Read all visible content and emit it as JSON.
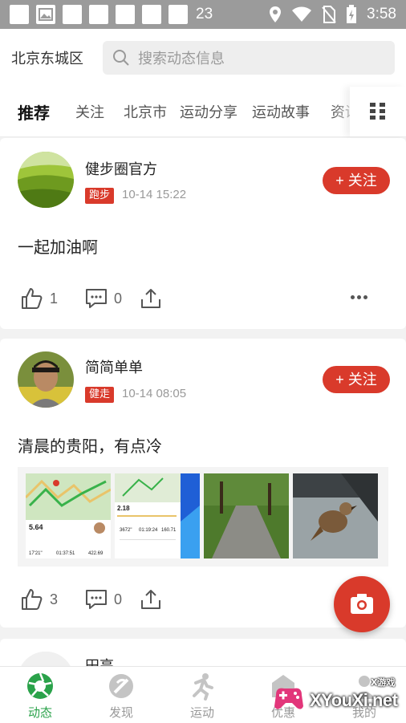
{
  "status_bar": {
    "notification_count": "23",
    "time": "3:58"
  },
  "header": {
    "city": "北京东城区",
    "search_placeholder": "搜索动态信息"
  },
  "tabs": [
    "推荐",
    "关注",
    "北京市",
    "运动分享",
    "运动故事",
    "资讯"
  ],
  "feed": [
    {
      "user": "健步圈官方",
      "tag": "跑步",
      "time": "10-14 15:22",
      "follow_label": "+ 关注",
      "text": "一起加油啊",
      "likes": "1",
      "comments": "0",
      "has_images": false
    },
    {
      "user": "简简单单",
      "tag": "健走",
      "time": "10-14 08:05",
      "follow_label": "+ 关注",
      "text": "清晨的贵阳，有点冷",
      "likes": "3",
      "comments": "0",
      "has_images": true,
      "image_stats": {
        "distance": "5.64",
        "time": "17'21\"",
        "duration": "01:37:51",
        "calories": "422.69",
        "distance2": "2.18",
        "pace": "3672\"",
        "duration2": "01:19:24",
        "kcal2": "160.71"
      }
    },
    {
      "user": "田亮"
    }
  ],
  "bottom_nav": [
    "动态",
    "发现",
    "运动",
    "优惠",
    "我的"
  ],
  "watermark": {
    "text": "XYouXi.net",
    "small": "X游戏"
  },
  "colors": {
    "accent_red": "#d93a2b",
    "active_green": "#2aa24a"
  }
}
